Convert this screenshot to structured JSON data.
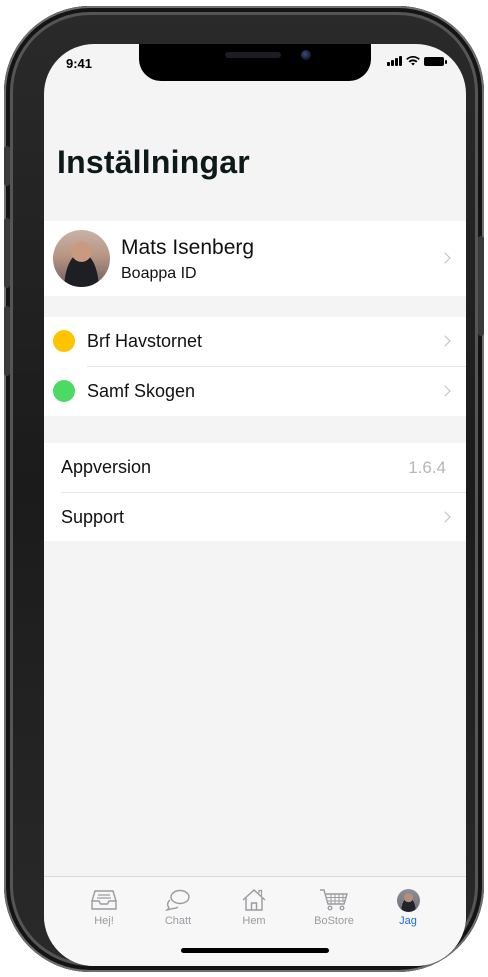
{
  "status_bar": {
    "time": "9:41"
  },
  "header": {
    "title": "Inställningar"
  },
  "profile": {
    "name": "Mats Isenberg",
    "subtitle": "Boappa ID"
  },
  "organizations": [
    {
      "label": "Brf Havstornet",
      "color": "#ffc400"
    },
    {
      "label": "Samf Skogen",
      "color": "#4cd964"
    }
  ],
  "info": {
    "version_label": "Appversion",
    "version_value": "1.6.4",
    "support_label": "Support"
  },
  "tabbar": {
    "active": "Jag",
    "accent": "#1a6fe0",
    "tabs": [
      {
        "label": "Hej!",
        "icon": "inbox-icon"
      },
      {
        "label": "Chatt",
        "icon": "chat-bubbles-icon"
      },
      {
        "label": "Hem",
        "icon": "house-icon"
      },
      {
        "label": "BoStore",
        "icon": "cart-icon"
      },
      {
        "label": "Jag",
        "icon": "avatar-icon"
      }
    ]
  }
}
